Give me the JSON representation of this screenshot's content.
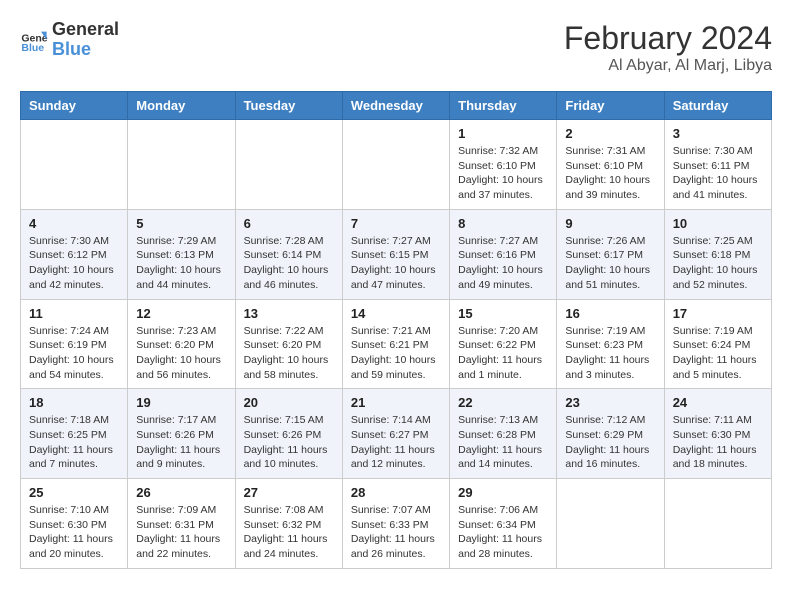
{
  "header": {
    "logo_line1": "General",
    "logo_line2": "Blue",
    "month_year": "February 2024",
    "location": "Al Abyar, Al Marj, Libya"
  },
  "days_of_week": [
    "Sunday",
    "Monday",
    "Tuesday",
    "Wednesday",
    "Thursday",
    "Friday",
    "Saturday"
  ],
  "weeks": [
    [
      {
        "day": "",
        "info": ""
      },
      {
        "day": "",
        "info": ""
      },
      {
        "day": "",
        "info": ""
      },
      {
        "day": "",
        "info": ""
      },
      {
        "day": "1",
        "info": "Sunrise: 7:32 AM\nSunset: 6:10 PM\nDaylight: 10 hours and 37 minutes."
      },
      {
        "day": "2",
        "info": "Sunrise: 7:31 AM\nSunset: 6:10 PM\nDaylight: 10 hours and 39 minutes."
      },
      {
        "day": "3",
        "info": "Sunrise: 7:30 AM\nSunset: 6:11 PM\nDaylight: 10 hours and 41 minutes."
      }
    ],
    [
      {
        "day": "4",
        "info": "Sunrise: 7:30 AM\nSunset: 6:12 PM\nDaylight: 10 hours and 42 minutes."
      },
      {
        "day": "5",
        "info": "Sunrise: 7:29 AM\nSunset: 6:13 PM\nDaylight: 10 hours and 44 minutes."
      },
      {
        "day": "6",
        "info": "Sunrise: 7:28 AM\nSunset: 6:14 PM\nDaylight: 10 hours and 46 minutes."
      },
      {
        "day": "7",
        "info": "Sunrise: 7:27 AM\nSunset: 6:15 PM\nDaylight: 10 hours and 47 minutes."
      },
      {
        "day": "8",
        "info": "Sunrise: 7:27 AM\nSunset: 6:16 PM\nDaylight: 10 hours and 49 minutes."
      },
      {
        "day": "9",
        "info": "Sunrise: 7:26 AM\nSunset: 6:17 PM\nDaylight: 10 hours and 51 minutes."
      },
      {
        "day": "10",
        "info": "Sunrise: 7:25 AM\nSunset: 6:18 PM\nDaylight: 10 hours and 52 minutes."
      }
    ],
    [
      {
        "day": "11",
        "info": "Sunrise: 7:24 AM\nSunset: 6:19 PM\nDaylight: 10 hours and 54 minutes."
      },
      {
        "day": "12",
        "info": "Sunrise: 7:23 AM\nSunset: 6:20 PM\nDaylight: 10 hours and 56 minutes."
      },
      {
        "day": "13",
        "info": "Sunrise: 7:22 AM\nSunset: 6:20 PM\nDaylight: 10 hours and 58 minutes."
      },
      {
        "day": "14",
        "info": "Sunrise: 7:21 AM\nSunset: 6:21 PM\nDaylight: 10 hours and 59 minutes."
      },
      {
        "day": "15",
        "info": "Sunrise: 7:20 AM\nSunset: 6:22 PM\nDaylight: 11 hours and 1 minute."
      },
      {
        "day": "16",
        "info": "Sunrise: 7:19 AM\nSunset: 6:23 PM\nDaylight: 11 hours and 3 minutes."
      },
      {
        "day": "17",
        "info": "Sunrise: 7:19 AM\nSunset: 6:24 PM\nDaylight: 11 hours and 5 minutes."
      }
    ],
    [
      {
        "day": "18",
        "info": "Sunrise: 7:18 AM\nSunset: 6:25 PM\nDaylight: 11 hours and 7 minutes."
      },
      {
        "day": "19",
        "info": "Sunrise: 7:17 AM\nSunset: 6:26 PM\nDaylight: 11 hours and 9 minutes."
      },
      {
        "day": "20",
        "info": "Sunrise: 7:15 AM\nSunset: 6:26 PM\nDaylight: 11 hours and 10 minutes."
      },
      {
        "day": "21",
        "info": "Sunrise: 7:14 AM\nSunset: 6:27 PM\nDaylight: 11 hours and 12 minutes."
      },
      {
        "day": "22",
        "info": "Sunrise: 7:13 AM\nSunset: 6:28 PM\nDaylight: 11 hours and 14 minutes."
      },
      {
        "day": "23",
        "info": "Sunrise: 7:12 AM\nSunset: 6:29 PM\nDaylight: 11 hours and 16 minutes."
      },
      {
        "day": "24",
        "info": "Sunrise: 7:11 AM\nSunset: 6:30 PM\nDaylight: 11 hours and 18 minutes."
      }
    ],
    [
      {
        "day": "25",
        "info": "Sunrise: 7:10 AM\nSunset: 6:30 PM\nDaylight: 11 hours and 20 minutes."
      },
      {
        "day": "26",
        "info": "Sunrise: 7:09 AM\nSunset: 6:31 PM\nDaylight: 11 hours and 22 minutes."
      },
      {
        "day": "27",
        "info": "Sunrise: 7:08 AM\nSunset: 6:32 PM\nDaylight: 11 hours and 24 minutes."
      },
      {
        "day": "28",
        "info": "Sunrise: 7:07 AM\nSunset: 6:33 PM\nDaylight: 11 hours and 26 minutes."
      },
      {
        "day": "29",
        "info": "Sunrise: 7:06 AM\nSunset: 6:34 PM\nDaylight: 11 hours and 28 minutes."
      },
      {
        "day": "",
        "info": ""
      },
      {
        "day": "",
        "info": ""
      }
    ]
  ]
}
